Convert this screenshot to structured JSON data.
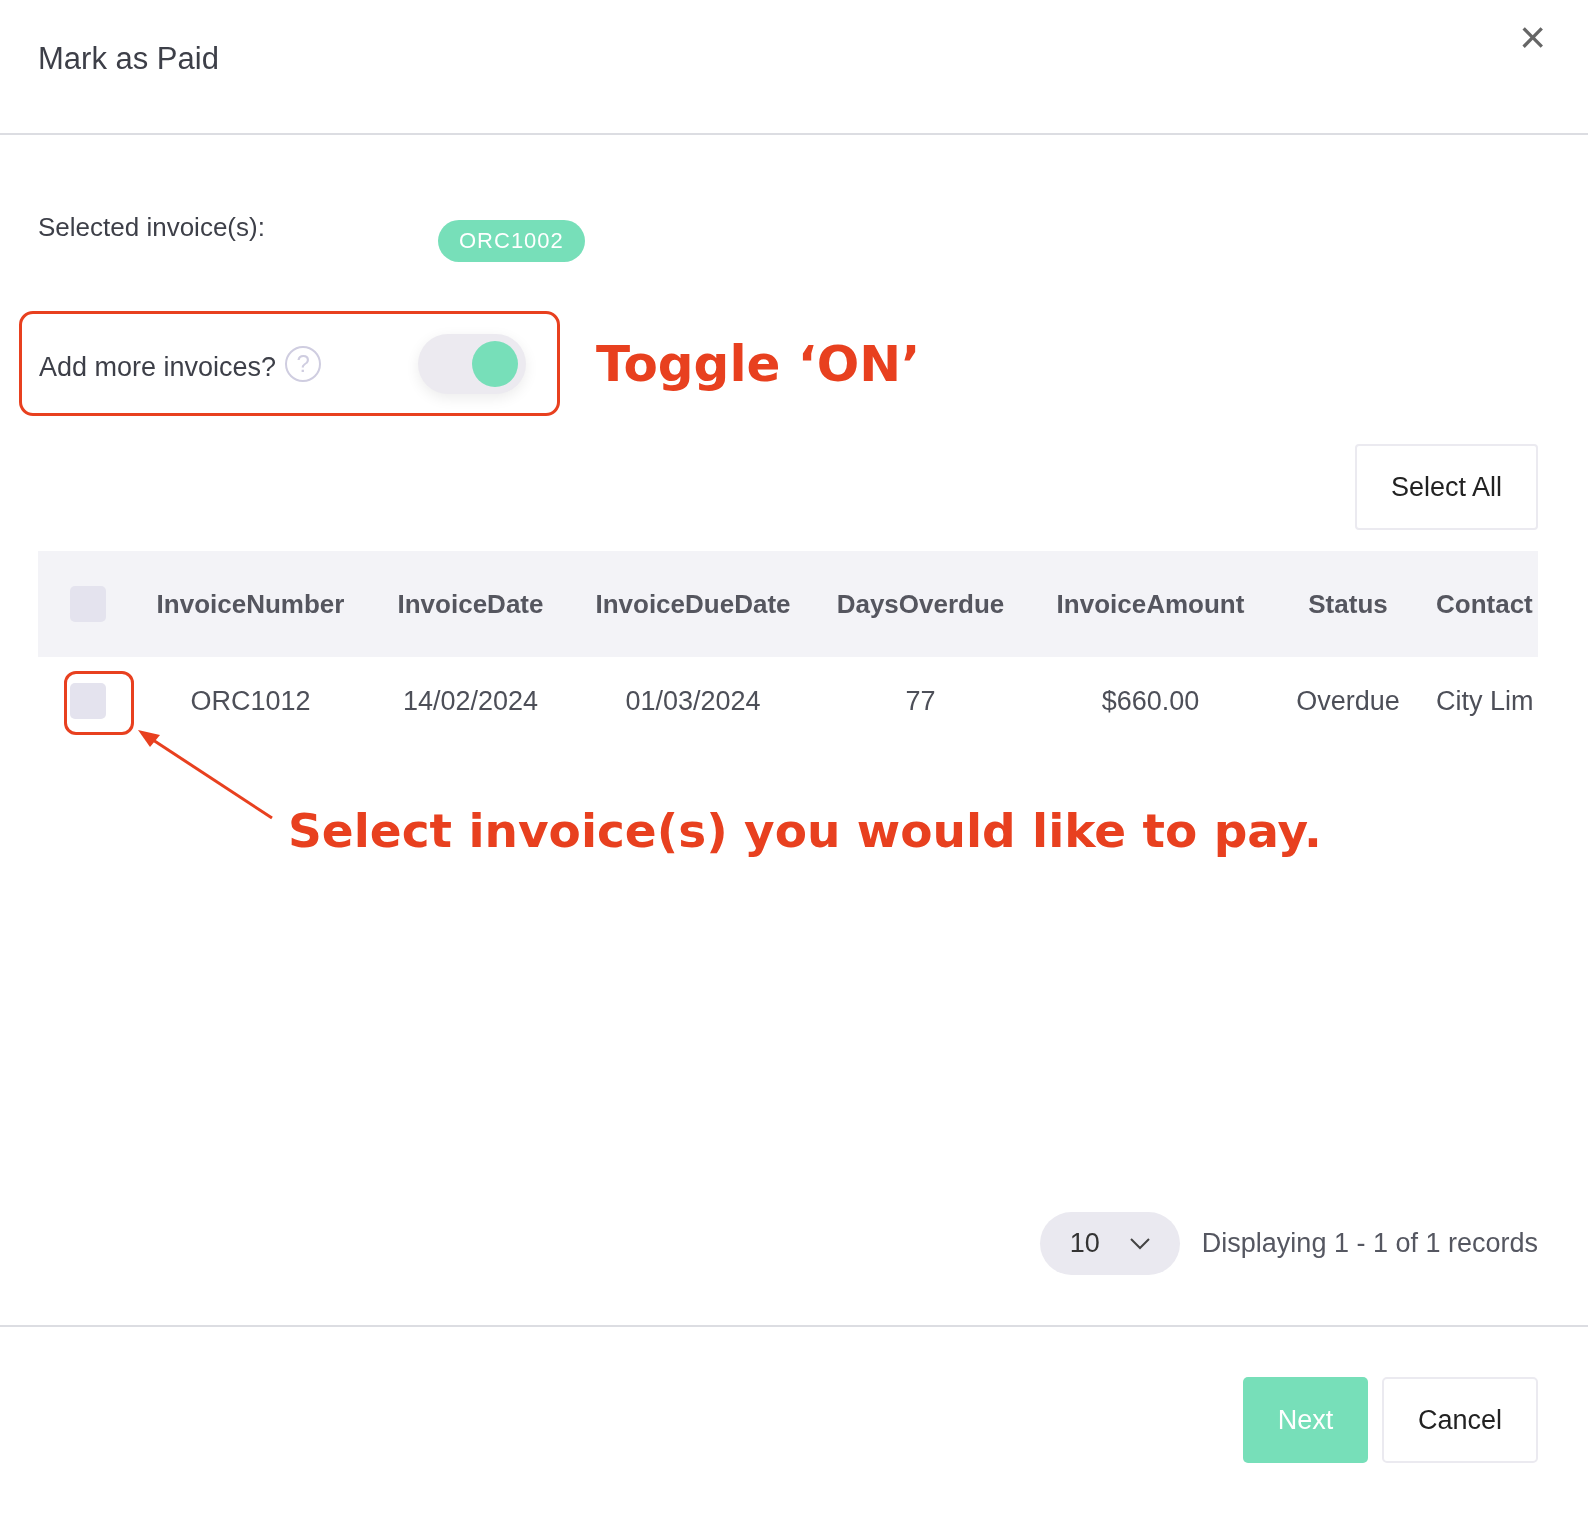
{
  "dialog": {
    "title": "Mark as Paid",
    "close_icon": "×"
  },
  "selected": {
    "label": "Selected invoice(s):",
    "tags": [
      "ORC1002"
    ]
  },
  "add_more": {
    "label": "Add more invoices?",
    "help": "?",
    "on": true
  },
  "select_all": "Select All",
  "table": {
    "columns": [
      "InvoiceNumber",
      "InvoiceDate",
      "InvoiceDueDate",
      "DaysOverdue",
      "InvoiceAmount",
      "Status",
      "Contact"
    ],
    "header_checked": false,
    "rows": [
      {
        "checked": false,
        "cells": [
          "ORC1012",
          "14/02/2024",
          "01/03/2024",
          "77",
          "$660.00",
          "Overdue",
          "City Lim"
        ]
      }
    ]
  },
  "pager": {
    "page_size": "10",
    "summary": "Displaying 1 - 1 of 1 records"
  },
  "buttons": [
    {
      "label": "Next",
      "kind": "primary"
    },
    {
      "label": "Cancel",
      "kind": "secondary"
    }
  ],
  "annotations": [
    {
      "kind": "callout",
      "text": "Toggle ‘ON’"
    },
    {
      "kind": "arrow-callout",
      "text": "Select invoice(s) you would like to pay."
    }
  ]
}
